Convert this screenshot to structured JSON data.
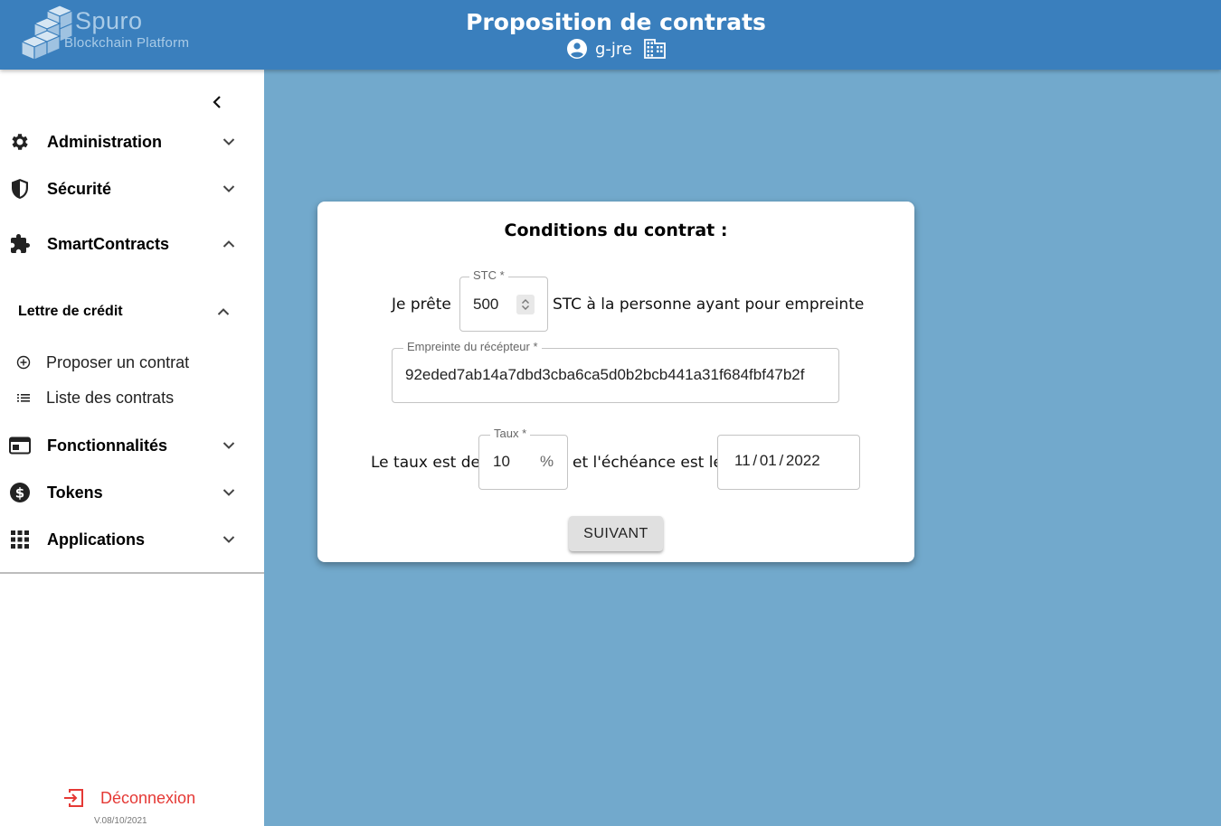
{
  "header": {
    "logo_name": "Spuro",
    "logo_subtitle": "Blockchain Platform",
    "title": "Proposition de contrats",
    "username": "g-jre",
    "user_icon": "account-circle-icon",
    "org_icon": "building-icon",
    "color": "#3a7fbd"
  },
  "sidebar": {
    "items": [
      {
        "label": "Administration",
        "icon": "gear-icon",
        "expanded": false
      },
      {
        "label": "Sécurité",
        "icon": "shield-icon",
        "expanded": false
      },
      {
        "label": "SmartContracts",
        "icon": "puzzle-icon",
        "expanded": true
      },
      {
        "label": "Fonctionnalités",
        "icon": "web-window-icon",
        "expanded": false
      },
      {
        "label": "Tokens",
        "icon": "dollar-circle-icon",
        "expanded": false
      },
      {
        "label": "Applications",
        "icon": "apps-grid-icon",
        "expanded": false
      }
    ],
    "submenu": {
      "title": "Lettre de crédit",
      "expanded": true,
      "items": [
        {
          "label": "Proposer un contrat",
          "icon": "add-circle-icon"
        },
        {
          "label": "Liste des contrats",
          "icon": "list-icon"
        }
      ]
    },
    "logout_label": "Déconnexion",
    "version": "V.08/10/2021",
    "logout_color": "#e53935"
  },
  "form": {
    "title": "Conditions du contrat :",
    "text_lend": "Je prête",
    "stc_label": "STC *",
    "stc_value": "500",
    "text_after_stc": "STC à la personne ayant pour empreinte",
    "fingerprint_label": "Empreinte du récépteur *",
    "fingerprint_value": "92eded7ab14a7dbd3cba6ca5d0b2bcb441a31f684fbf47b2f",
    "text_rate": "Le taux est de",
    "rate_label": "Taux *",
    "rate_value": "10",
    "rate_unit": "%",
    "text_due": "et l'échéance est le",
    "due_date": "11 / 01 / 2022",
    "next_button": "SUIVANT"
  },
  "background_color": "#72a9cc"
}
